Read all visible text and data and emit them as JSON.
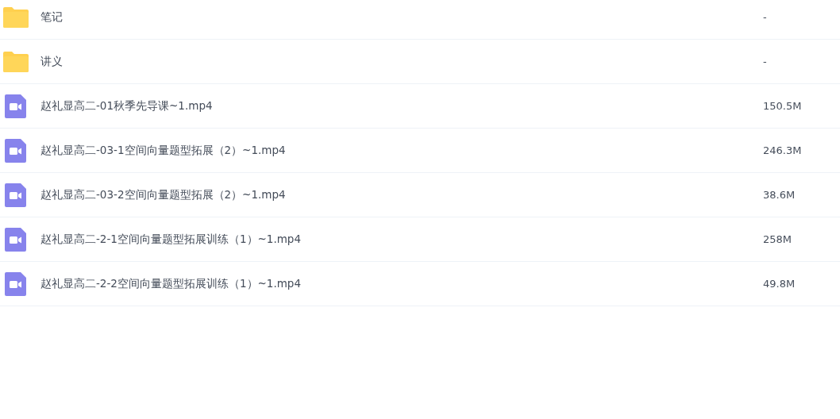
{
  "files": [
    {
      "kind": "folder",
      "name": "笔记",
      "size": "-"
    },
    {
      "kind": "folder",
      "name": "讲义",
      "size": "-"
    },
    {
      "kind": "video",
      "name": "赵礼显高二-01秋季先导课~1.mp4",
      "size": "150.5M"
    },
    {
      "kind": "video",
      "name": "赵礼显高二-03-1空间向量题型拓展（2）~1.mp4",
      "size": "246.3M"
    },
    {
      "kind": "video",
      "name": "赵礼显高二-03-2空间向量题型拓展（2）~1.mp4",
      "size": "38.6M"
    },
    {
      "kind": "video",
      "name": "赵礼显高二-2-1空间向量题型拓展训练（1）~1.mp4",
      "size": "258M"
    },
    {
      "kind": "video",
      "name": "赵礼显高二-2-2空间向量题型拓展训练（1）~1.mp4",
      "size": "49.8M"
    }
  ]
}
